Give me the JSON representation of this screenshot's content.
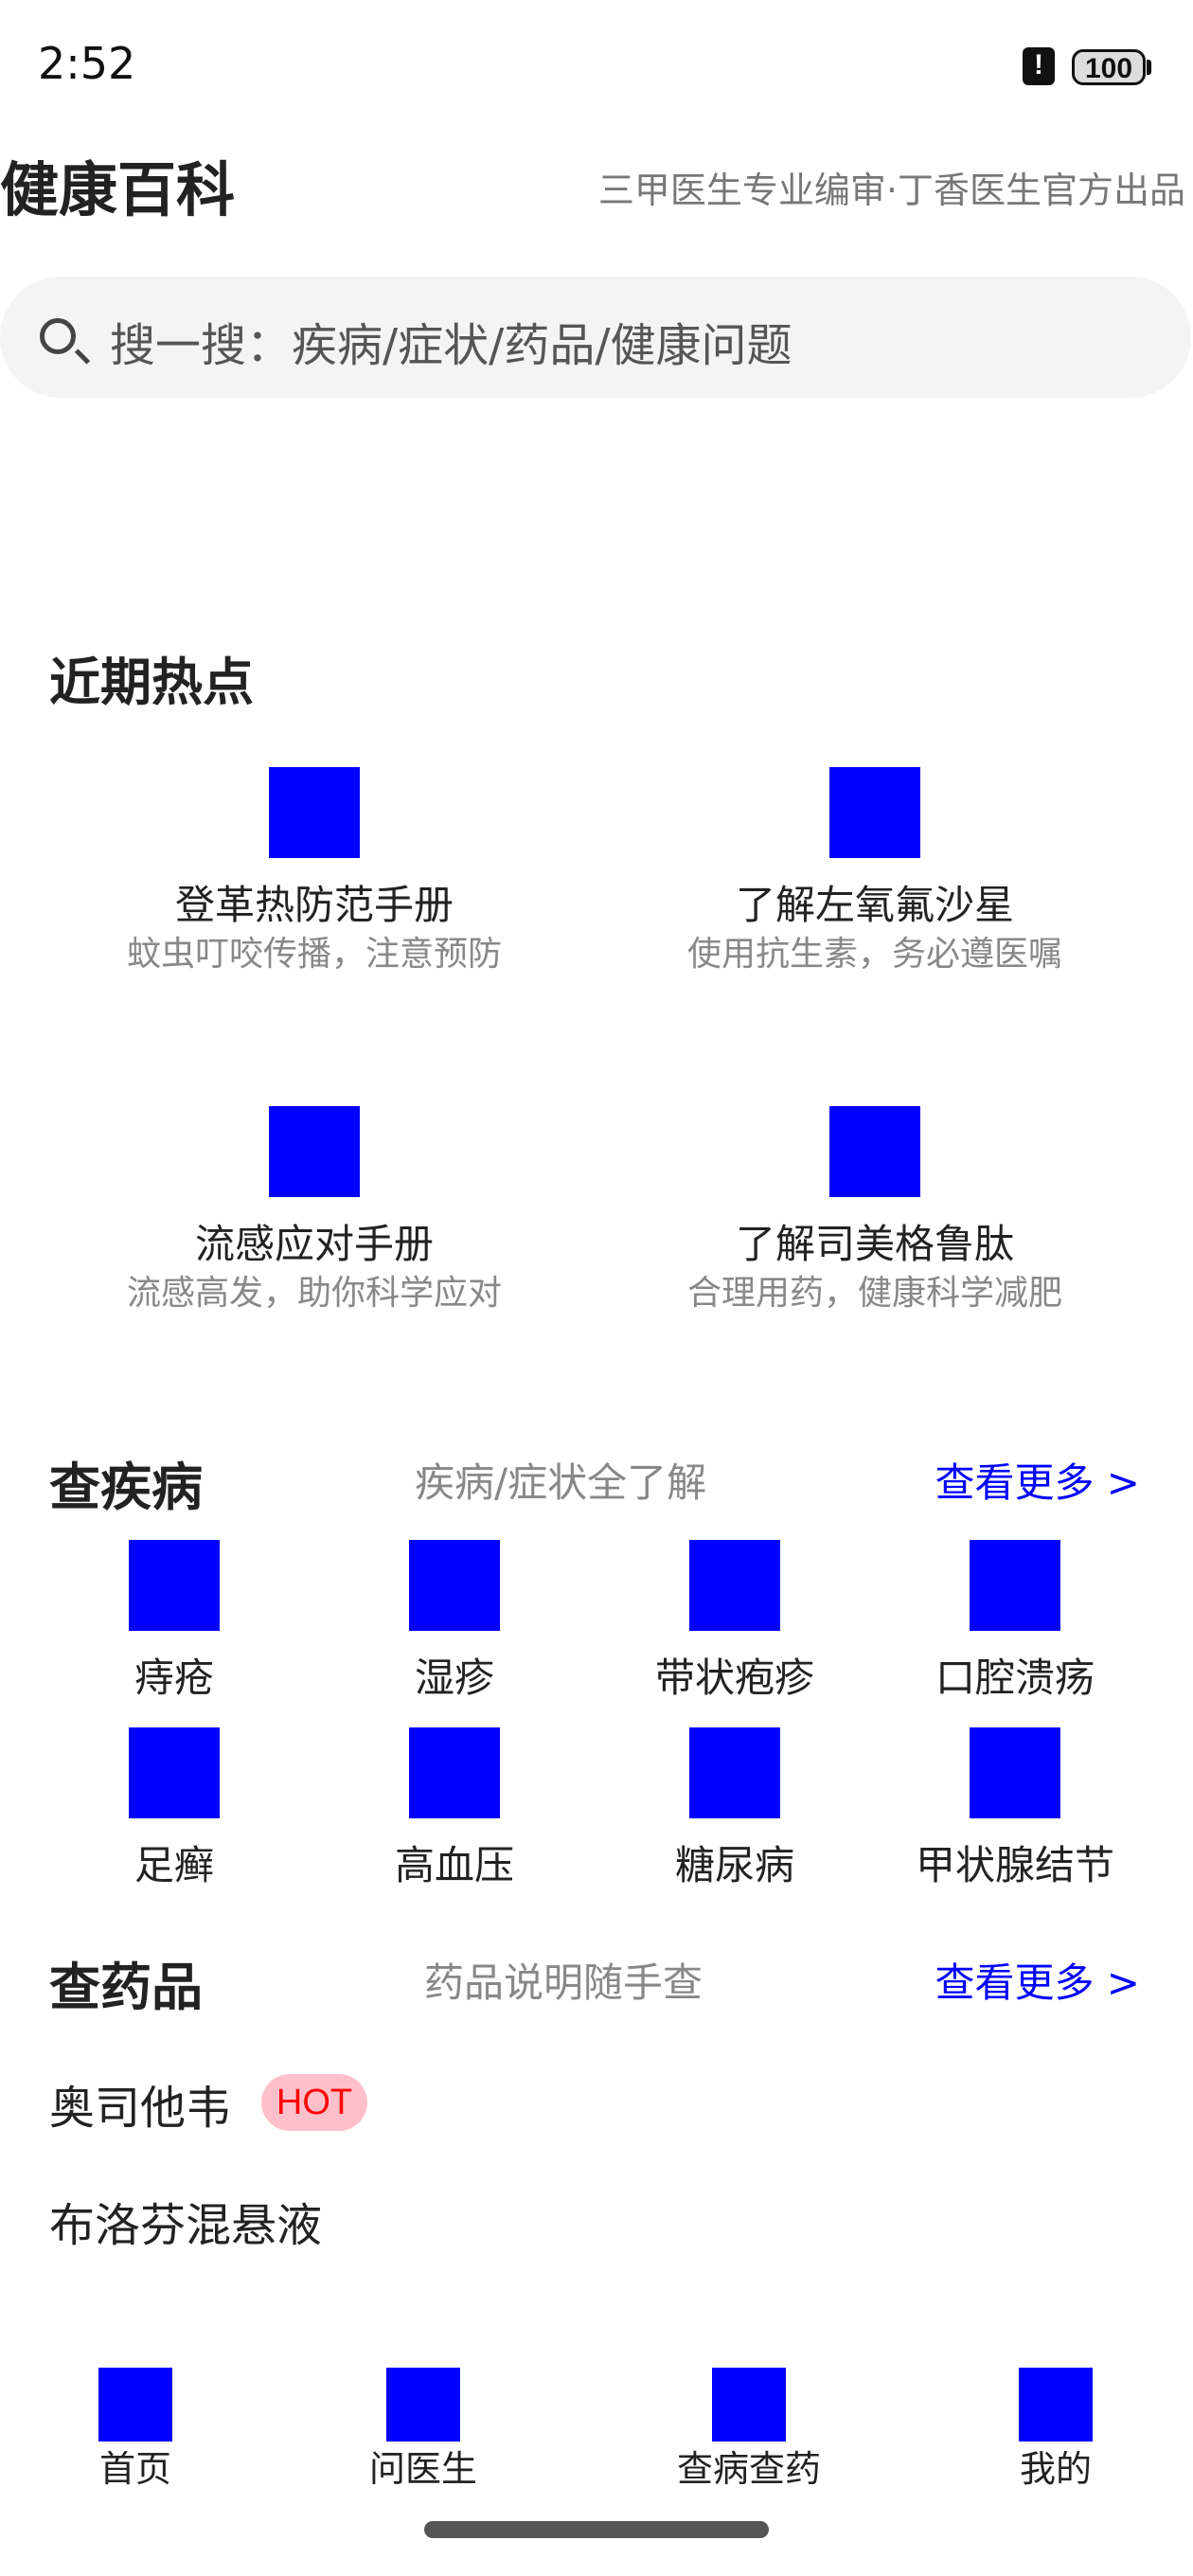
{
  "status_bar": {
    "time": "2:52",
    "alert_glyph": "!",
    "battery": "100"
  },
  "header": {
    "title": "健康百科",
    "subtitle": "三甲医生专业编审·丁香医生官方出品"
  },
  "search": {
    "placeholder": "搜一搜：疾病/症状/药品/健康问题",
    "icon": "search-icon"
  },
  "hot_topics": {
    "title": "近期热点",
    "items": [
      {
        "title": "登革热防范手册",
        "subtitle": "蚊虫叮咬传播，注意预防"
      },
      {
        "title": "了解左氧氟沙星",
        "subtitle": "使用抗生素，务必遵医嘱"
      },
      {
        "title": "流感应对手册",
        "subtitle": "流感高发，助你科学应对"
      },
      {
        "title": "了解司美格鲁肽",
        "subtitle": "合理用药，健康科学减肥"
      }
    ]
  },
  "diseases": {
    "title": "查疾病",
    "subtitle": "疾病/症状全了解",
    "more": "查看更多 >",
    "items": [
      "痔疮",
      "湿疹",
      "带状疱疹",
      "口腔溃疡",
      "足癣",
      "高血压",
      "糖尿病",
      "甲状腺结节"
    ]
  },
  "drugs": {
    "title": "查药品",
    "subtitle": "药品说明随手查",
    "more": "查看更多 >",
    "items": [
      {
        "name": "奥司他韦",
        "badge": "HOT"
      },
      {
        "name": "布洛芬混悬液"
      }
    ]
  },
  "bottom_nav": {
    "items": [
      "首页",
      "问医生",
      "查病查药",
      "我的"
    ]
  },
  "colors": {
    "placeholder_image": "#0000ff",
    "link": "#0000ff",
    "hot_badge_bg": "#ffc0cb",
    "hot_badge_text": "#ff0000"
  }
}
